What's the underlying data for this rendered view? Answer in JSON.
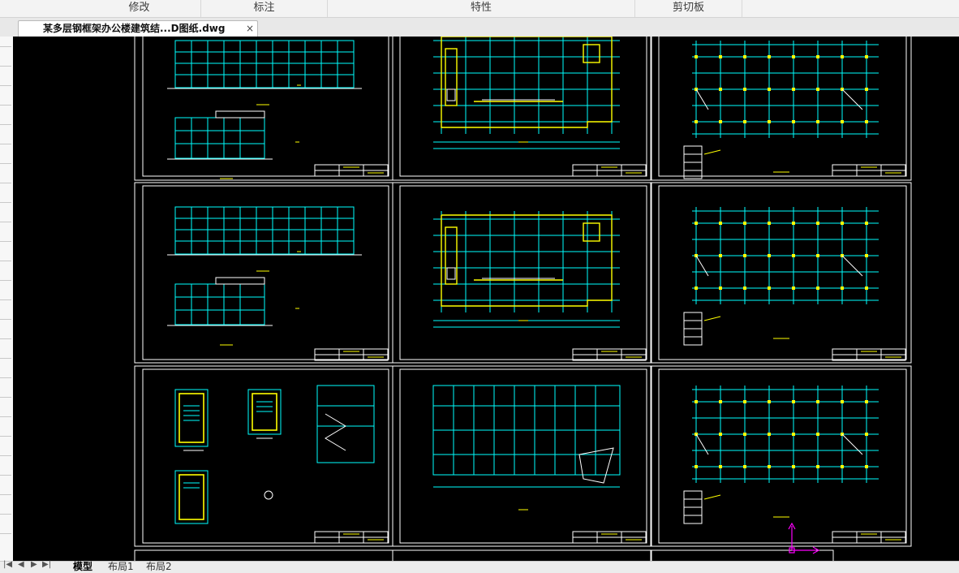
{
  "ribbon": {
    "groups": [
      "修改",
      "标注",
      "特性",
      "剪切板"
    ]
  },
  "document_tab": {
    "title": "某多层钢框架办公楼建筑结...D图纸.dwg",
    "close_glyph": "×"
  },
  "layout_tabs": {
    "nav_glyphs": [
      "|◀",
      "◀",
      "▶",
      "▶|"
    ],
    "tabs": [
      "模型",
      "布局1",
      "布局2"
    ],
    "active": "模型"
  },
  "colors": {
    "sheet_border": "#ffffff",
    "cyan": "#00ffff",
    "yellow": "#ffff00",
    "magenta": "#ff00ff",
    "canvas": "#000000"
  },
  "icons": [
    "close-icon",
    "first-layout-icon",
    "prev-layout-icon",
    "next-layout-icon",
    "last-layout-icon",
    "ucs-axis-icon"
  ]
}
